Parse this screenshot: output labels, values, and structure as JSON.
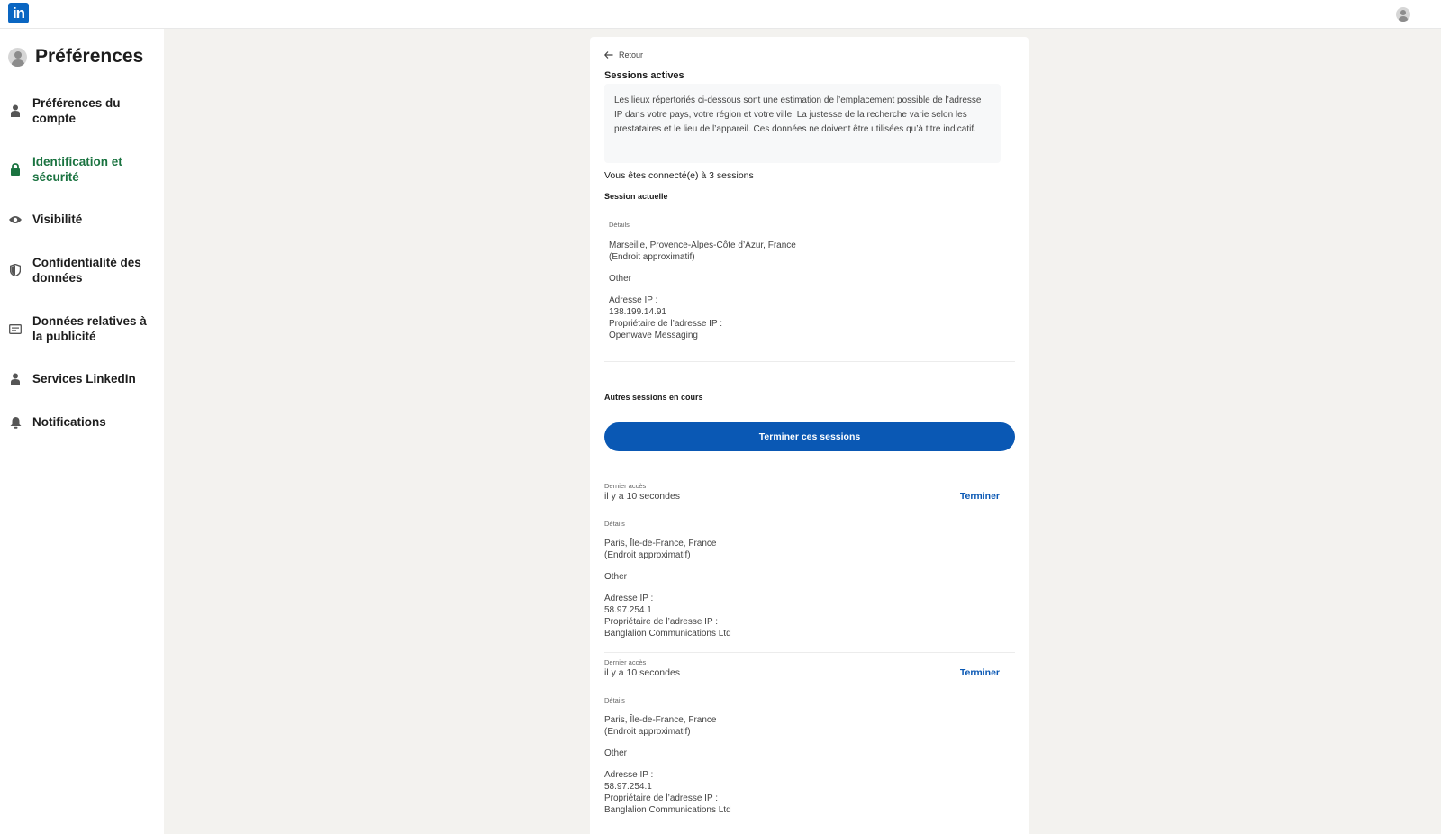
{
  "topbar": {
    "logo_text": "in",
    "logo_icon": "linkedin-logo",
    "avatar_icon": "user-avatar-icon"
  },
  "sidebar": {
    "title": "Préférences",
    "items": [
      {
        "label_line1": "Préférences du",
        "label_line2": "compte",
        "icon": "person-icon",
        "active": false
      },
      {
        "label_line1": "Identification et",
        "label_line2": "sécurité",
        "icon": "lock-icon",
        "active": true
      },
      {
        "label_line1": "Visibilité",
        "label_line2": "",
        "icon": "eye-icon",
        "active": false
      },
      {
        "label_line1": "Confidentialité des",
        "label_line2": "données",
        "icon": "shield-icon",
        "active": false
      },
      {
        "label_line1": "Données relatives à",
        "label_line2": "la publicité",
        "icon": "ad-card-icon",
        "active": false
      },
      {
        "label_line1": "Services LinkedIn",
        "label_line2": "",
        "icon": "person-icon",
        "active": false
      },
      {
        "label_line1": "Notifications",
        "label_line2": "",
        "icon": "bell-icon",
        "active": false
      }
    ]
  },
  "main": {
    "back_label": "Retour",
    "heading": "Sessions actives",
    "info_text": "Les lieux répertoriés ci-dessous sont une estimation de l’emplacement possible de l’adresse IP dans votre pays, votre région et votre ville. La justesse de la recherche varie selon les prestataires et le lieu de l’appareil. Ces données ne doivent être utilisées qu’à titre indicatif.",
    "connected_text": "Vous êtes connecté(e) à 3 sessions",
    "current_heading": "Session actuelle",
    "current_session": {
      "details_label": "Détails",
      "location": "Marseille, Provence-Alpes-Côte d’Azur, France",
      "approx": "(Endroit approximatif)",
      "device": "Other",
      "ip_label": "Adresse IP :",
      "ip": "138.199.14.91",
      "owner_label": "Propriétaire de l’adresse IP :",
      "owner": "Openwave Messaging"
    },
    "others_heading": "Autres sessions en cours",
    "end_all_label": "Terminer ces sessions",
    "other_sessions": [
      {
        "last_access_label": "Dernier accès",
        "last_access": "il y a 10 secondes",
        "terminate_label": "Terminer",
        "details_label": "Détails",
        "location": "Paris, Île-de-France, France",
        "approx": "(Endroit approximatif)",
        "device": "Other",
        "ip_label": "Adresse IP :",
        "ip": "58.97.254.1",
        "owner_label": "Propriétaire de l’adresse IP :",
        "owner": "Banglalion Communications Ltd"
      },
      {
        "last_access_label": "Dernier accès",
        "last_access": "il y a 10 secondes",
        "terminate_label": "Terminer",
        "details_label": "Détails",
        "location": "Paris, Île-de-France, France",
        "approx": "(Endroit approximatif)",
        "device": "Other",
        "ip_label": "Adresse IP :",
        "ip": "58.97.254.1",
        "owner_label": "Propriétaire de l’adresse IP :",
        "owner": "Banglalion Communications Ltd"
      }
    ]
  },
  "colors": {
    "brand": "#0a66c2",
    "active_nav": "#1a7340",
    "button": "#0a58b4",
    "background": "#f3f2ef"
  }
}
